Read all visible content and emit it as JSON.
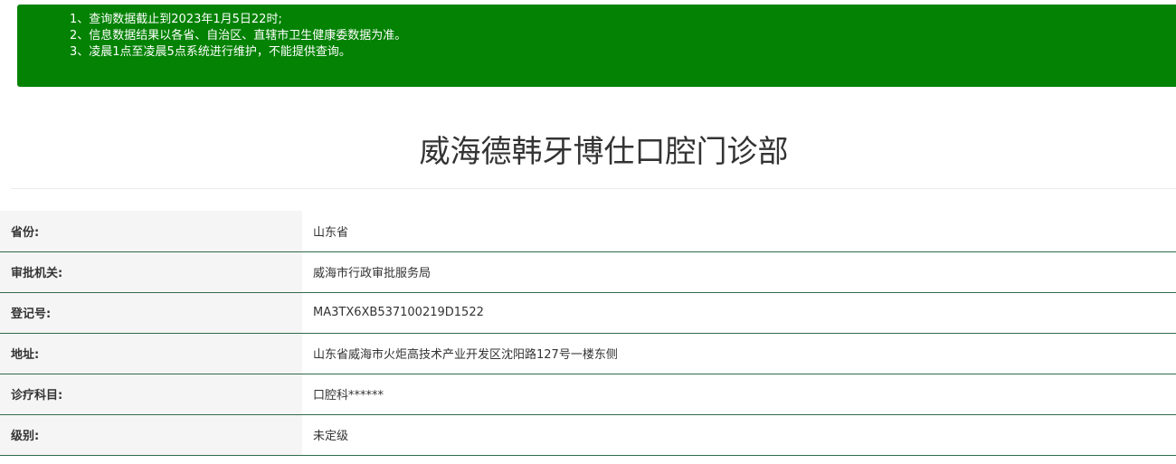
{
  "notice": {
    "lines": [
      "1、查询数据截止到2023年1月5日22时;",
      "2、信息数据结果以各省、自治区、直辖市卫生健康委数据为准。",
      "3、凌晨1点至凌晨5点系统进行维护，不能提供查询。"
    ]
  },
  "header": {
    "title": "威海德韩牙博仕口腔门诊部"
  },
  "details": {
    "rows": [
      {
        "label": "省份:",
        "value": "山东省"
      },
      {
        "label": "审批机关:",
        "value": "威海市行政审批服务局"
      },
      {
        "label": "登记号:",
        "value": "MA3TX6XB537100219D1522"
      },
      {
        "label": "地址:",
        "value": "山东省威海市火炬高技术产业开发区沈阳路127号一楼东侧"
      },
      {
        "label": "诊疗科目:",
        "value": "口腔科******"
      },
      {
        "label": "级别:",
        "value": "未定级"
      }
    ]
  },
  "colors": {
    "notice_bg": "#038203",
    "row_border": "#2f6b4b",
    "label_bg": "#f5f5f5"
  }
}
